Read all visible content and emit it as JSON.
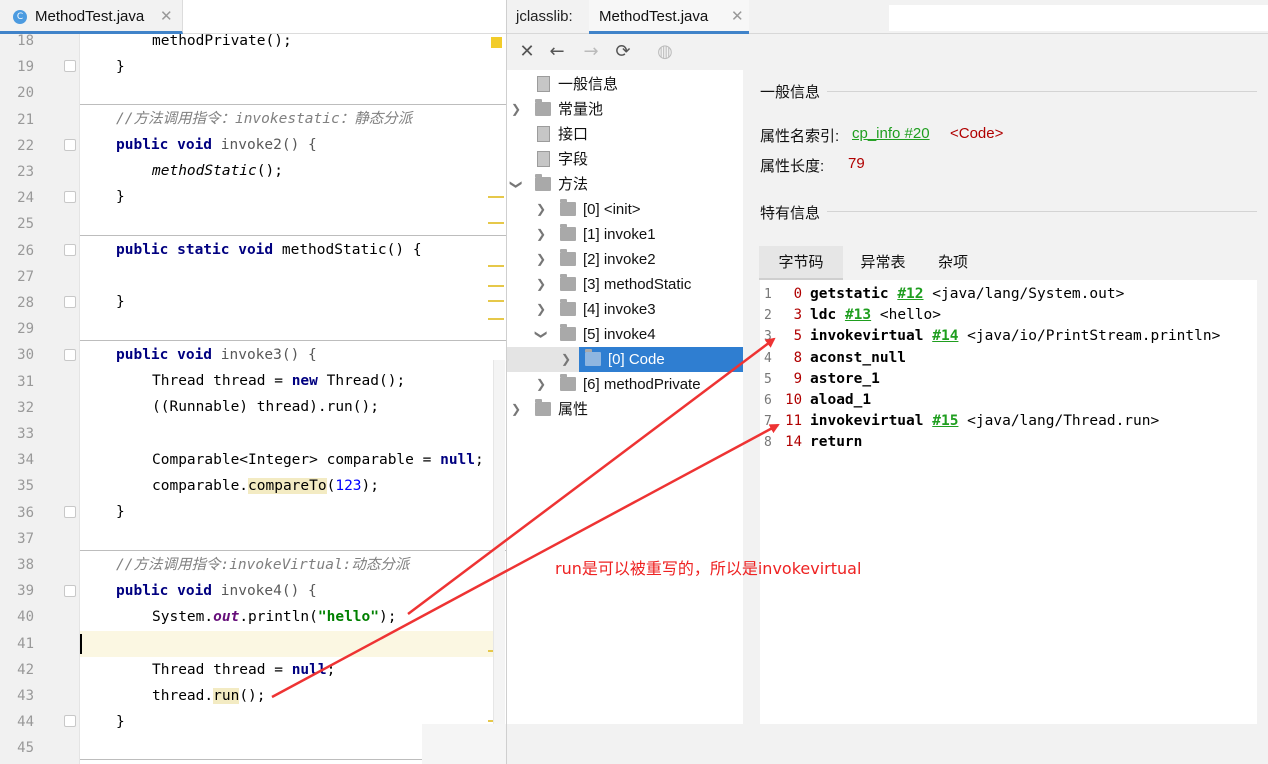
{
  "editor": {
    "tab_icon": "C",
    "tab_title": "MethodTest.java",
    "tab_close": "✕",
    "line_numbers": [
      "18",
      "19",
      "20",
      "21",
      "22",
      "23",
      "24",
      "25",
      "26",
      "27",
      "28",
      "29",
      "30",
      "31",
      "32",
      "33",
      "34",
      "35",
      "36",
      "37",
      "38",
      "39",
      "40",
      "41",
      "42",
      "43",
      "44",
      "45"
    ],
    "code": {
      "l18": "methodPrivate();",
      "l19": "}",
      "l21": "//方法调用指令：invokestatic：静态分派",
      "l22_kw": "public void",
      "l22_rest": " invoke2() {",
      "l23": "methodStatic",
      "l23_rest": "();",
      "l24": "}",
      "l26_kw": "public static void",
      "l26_rest": " methodStatic() {",
      "l28": "}",
      "l30_kw": "public void",
      "l30_rest": " invoke3() {",
      "l31_a": "Thread thread = ",
      "l31_kw": "new",
      "l31_b": " Thread();",
      "l32": "((Runnable) thread).run();",
      "l34_a": "Comparable<Integer> comparable = ",
      "l34_kw": "null",
      "l34_b": ";",
      "l35_a": "comparable.",
      "l35_hl": "compareTo",
      "l35_b": "(",
      "l35_num": "123",
      "l35_c": ");",
      "l36": "}",
      "l38": "//方法调用指令:invokeVirtual:动态分派",
      "l39_kw": "public void",
      "l39_rest": " invoke4() {",
      "l40_a": "System.",
      "l40_field": "out",
      "l40_b": ".println(",
      "l40_str": "\"hello\"",
      "l40_c": ");",
      "l42_a": "Thread thread = ",
      "l42_kw": "null",
      "l42_b": ";",
      "l43_a": "thread.",
      "l43_hl": "run",
      "l43_b": "();",
      "l44": "}"
    }
  },
  "jclasslib": {
    "label": "jclasslib:",
    "tab_title": "MethodTest.java",
    "tab_close": "✕",
    "toolbar": {
      "close": "✕",
      "back": "←",
      "forward": "→",
      "refresh": "⟳",
      "web": "◍"
    },
    "tree": {
      "general": "一般信息",
      "constant_pool": "常量池",
      "interfaces": "接口",
      "fields": "字段",
      "methods": "方法",
      "method_items": [
        "[0] <init>",
        "[1] invoke1",
        "[2] invoke2",
        "[3] methodStatic",
        "[4] invoke3",
        "[5] invoke4",
        "[6] methodPrivate"
      ],
      "code_item": "[0] Code",
      "attributes": "属性"
    },
    "detail": {
      "general_title": "一般信息",
      "attr_name_label": "属性名索引:",
      "attr_name_link": "cp_info #20",
      "attr_name_value": "<Code>",
      "attr_len_label": "属性长度:",
      "attr_len_value": "79",
      "specific_title": "特有信息",
      "tabs": [
        "字节码",
        "异常表",
        "杂项"
      ]
    },
    "bytecode": [
      {
        "line": "1",
        "offset": "0",
        "op": "getstatic",
        "ref": "#12",
        "arg": "<java/lang/System.out>"
      },
      {
        "line": "2",
        "offset": "3",
        "op": "ldc",
        "ref": "#13",
        "arg": "<hello>"
      },
      {
        "line": "3",
        "offset": "5",
        "op": "invokevirtual",
        "ref": "#14",
        "arg": "<java/io/PrintStream.println>"
      },
      {
        "line": "4",
        "offset": "8",
        "op": "aconst_null",
        "ref": "",
        "arg": ""
      },
      {
        "line": "5",
        "offset": "9",
        "op": "astore_1",
        "ref": "",
        "arg": ""
      },
      {
        "line": "6",
        "offset": "10",
        "op": "aload_1",
        "ref": "",
        "arg": ""
      },
      {
        "line": "7",
        "offset": "11",
        "op": "invokevirtual",
        "ref": "#15",
        "arg": "<java/lang/Thread.run>"
      },
      {
        "line": "8",
        "offset": "14",
        "op": "return",
        "ref": "",
        "arg": ""
      }
    ]
  },
  "annotation": "run是可以被重写的，所以是invokevirtual",
  "colors": {
    "annotation_red": "#ee2222",
    "selection_blue": "#2f7ed1",
    "link_green": "#1f9e1f",
    "value_red": "#b00000",
    "keyword_navy": "#000080"
  }
}
